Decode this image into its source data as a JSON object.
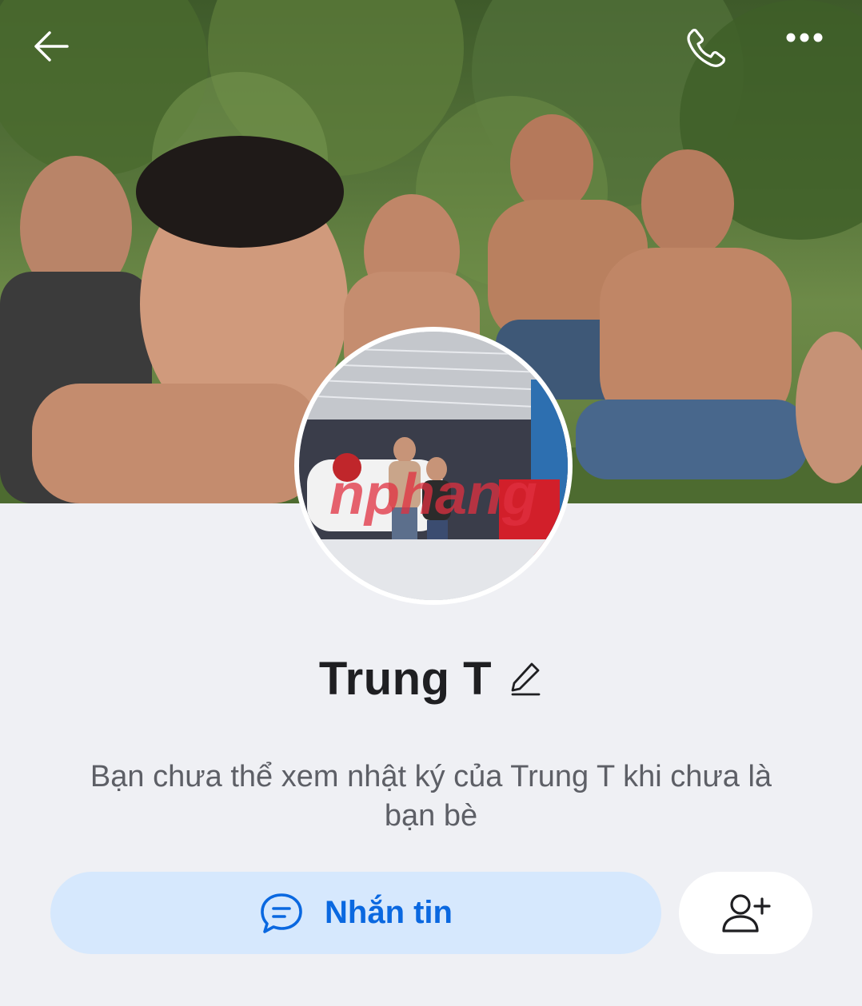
{
  "header": {
    "back_icon": "arrow-left-icon",
    "call_icon": "phone-icon",
    "more_icon": "more-horizontal-icon"
  },
  "cover": {
    "description_icon": "cover-photo"
  },
  "avatar": {
    "watermark": "nphang"
  },
  "profile": {
    "name": "Trung T",
    "edit_icon": "pencil-icon"
  },
  "notice": {
    "text": "Bạn chưa thể xem nhật ký của Trung T khi chưa là bạn bè"
  },
  "actions": {
    "message_label": "Nhắn tin",
    "message_icon": "chat-bubble-icon",
    "add_friend_icon": "add-friend-icon"
  },
  "colors": {
    "background": "#eff0f4",
    "accent": "#0a68e0",
    "accent_bg": "#d6e8fd"
  }
}
